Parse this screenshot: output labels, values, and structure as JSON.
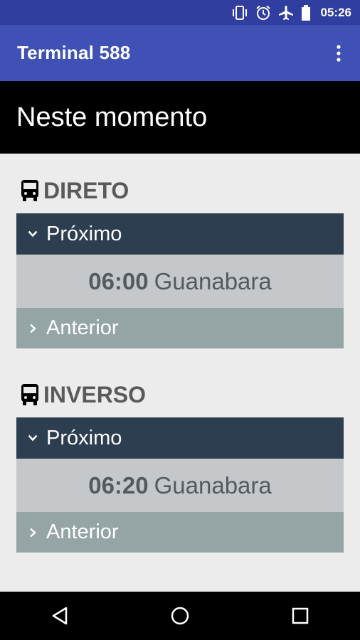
{
  "status_bar": {
    "time": "05:26",
    "icons": [
      "vibrate-icon",
      "alarm-icon",
      "airplane-icon",
      "battery-icon"
    ]
  },
  "app_bar": {
    "title": "Terminal 588",
    "menu_icon": "overflow-menu-icon"
  },
  "header": {
    "title": "Neste momento"
  },
  "sections": [
    {
      "heading": "DIRETO",
      "icon": "bus-icon",
      "next_label": "Próximo",
      "next_time": "06:00",
      "next_company": "Guanabara",
      "previous_label": "Anterior"
    },
    {
      "heading": "INVERSO",
      "icon": "bus-icon",
      "next_label": "Próximo",
      "next_time": "06:20",
      "next_company": "Guanabara",
      "previous_label": "Anterior"
    }
  ],
  "nav_bar": {
    "buttons": [
      "back-icon",
      "home-icon",
      "recents-icon"
    ]
  },
  "colors": {
    "status_bar": "#303f9f",
    "app_bar": "#3f51b5",
    "header": "#000000",
    "next_row": "#2c3e50",
    "value_row": "#c5c8cb",
    "previous_row": "#95a5a6",
    "background": "#ececec"
  }
}
